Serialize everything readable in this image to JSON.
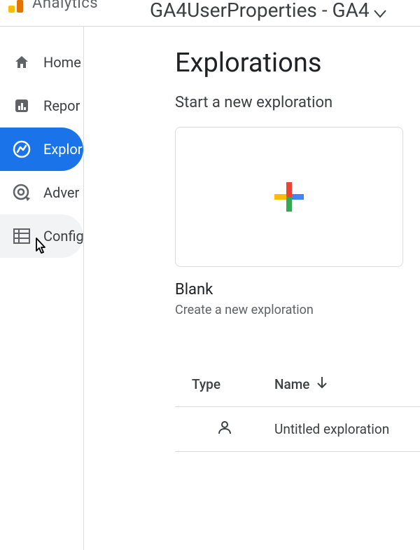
{
  "header": {
    "brand": "Analytics",
    "property": "GA4UserProperties - GA4"
  },
  "nav": {
    "home": "Home",
    "reports": "Repor",
    "explore": "Explor",
    "advertising": "Adver",
    "configure": "Config"
  },
  "page": {
    "title": "Explorations",
    "subhead": "Start a new exploration"
  },
  "blank_card": {
    "title": "Blank",
    "subtitle": "Create a new exploration"
  },
  "table": {
    "col_type": "Type",
    "col_name": "Name",
    "rows": [
      {
        "name": "Untitled exploration"
      }
    ]
  }
}
